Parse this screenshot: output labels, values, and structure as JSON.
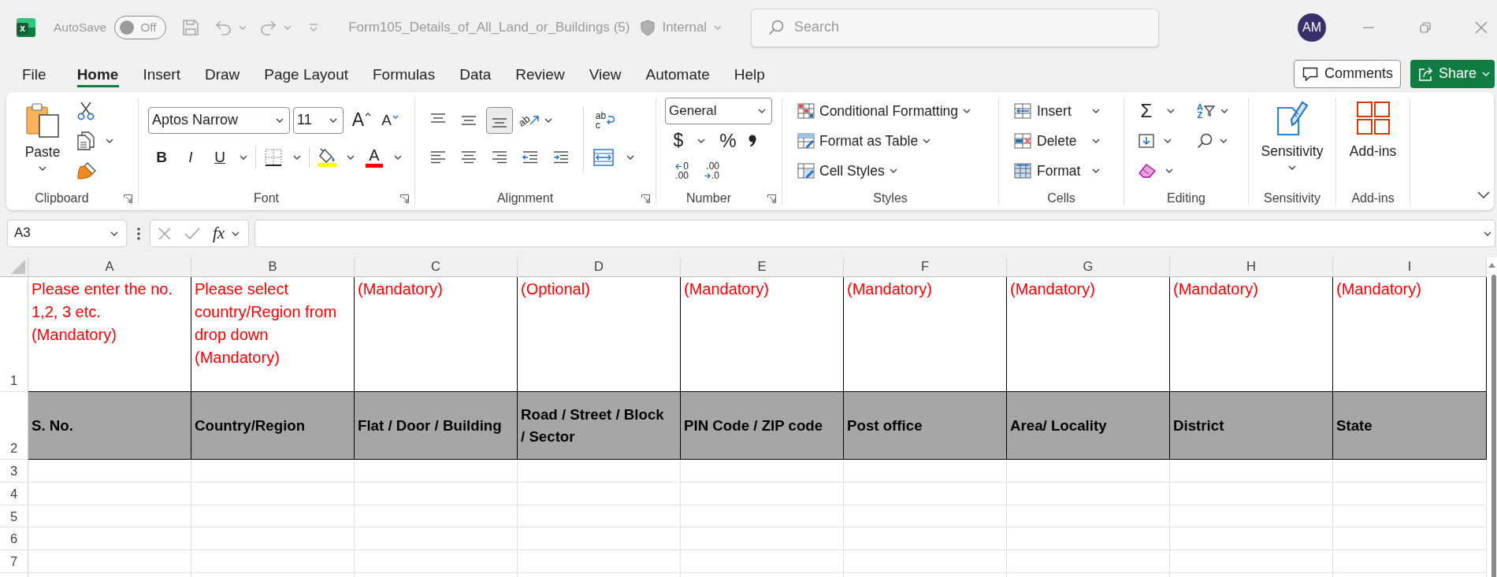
{
  "title_bar": {
    "logo_letter": "x",
    "autosave": {
      "label": "AutoSave",
      "state_text": "Off",
      "on": false
    },
    "document_title": "Form105_Details_of_All_Land_or_Buildings (5)",
    "sensitivity_label": "Internal",
    "search": {
      "placeholder": "Search"
    },
    "account_initials": "AM"
  },
  "ribbon_tabs": [
    {
      "label": "File",
      "selected": false
    },
    {
      "label": "Home",
      "selected": true
    },
    {
      "label": "Insert",
      "selected": false
    },
    {
      "label": "Draw",
      "selected": false
    },
    {
      "label": "Page Layout",
      "selected": false
    },
    {
      "label": "Formulas",
      "selected": false
    },
    {
      "label": "Data",
      "selected": false
    },
    {
      "label": "Review",
      "selected": false
    },
    {
      "label": "View",
      "selected": false
    },
    {
      "label": "Automate",
      "selected": false
    },
    {
      "label": "Help",
      "selected": false
    }
  ],
  "header_buttons": [
    {
      "kind": "comments",
      "label": "Comments"
    },
    {
      "kind": "share",
      "label": "Share"
    }
  ],
  "ribbon_groups": [
    {
      "kind": "clipboard",
      "label": "Clipboard",
      "launcher": true,
      "paste_label": "Paste"
    },
    {
      "kind": "font",
      "label": "Font",
      "launcher": true,
      "font_name": "Aptos Narrow",
      "font_size": "11",
      "grow_glyph": "A",
      "shrink_glyph": "A",
      "style_buttons": [
        "B",
        "I",
        "U"
      ],
      "font_color_glyph": "A"
    },
    {
      "kind": "alignment",
      "label": "Alignment",
      "launcher": true,
      "vertical_align": [
        {
          "selected": false
        },
        {
          "selected": false
        },
        {
          "selected": true
        }
      ],
      "orientation_glyph": "ab",
      "wrap_glyph": [
        "ab",
        "c"
      ]
    },
    {
      "kind": "number",
      "label": "Number",
      "launcher": true,
      "number_format": "General",
      "currency_glyph": "$",
      "percent_glyph": "%",
      "increase_decimal": [
        "0",
        ".00"
      ],
      "decrease_decimal": [
        ".00",
        ".0"
      ]
    },
    {
      "kind": "styles",
      "label": "Styles",
      "launcher": false,
      "items": [
        "Conditional Formatting",
        "Format as Table",
        "Cell Styles"
      ]
    },
    {
      "kind": "cells",
      "label": "Cells",
      "launcher": false,
      "items": [
        "Insert",
        "Delete",
        "Format"
      ]
    },
    {
      "kind": "editing",
      "label": "Editing",
      "launcher": false,
      "sum_glyph": "Σ",
      "sort_glyph": [
        "A",
        "Z"
      ]
    },
    {
      "kind": "sensitivity",
      "label": "Sensitivity",
      "launcher": false,
      "button_label": "Sensitivity"
    },
    {
      "kind": "addins",
      "label": "Add-ins",
      "launcher": false,
      "button_label": "Add-ins"
    }
  ],
  "formula_bar": {
    "name_box": "A3",
    "function_label": "fx"
  },
  "sheet": {
    "columns": [
      "A",
      "B",
      "C",
      "D",
      "E",
      "F",
      "G",
      "H",
      "I"
    ],
    "rows": [
      {
        "number": "1",
        "kind": "note",
        "cells": [
          "Please enter the no. 1,2, 3 etc. (Mandatory)",
          "Please select country/Region from drop down (Mandatory)",
          "(Mandatory)",
          "(Optional)",
          "(Mandatory)",
          "(Mandatory)",
          "(Mandatory)",
          "(Mandatory)",
          "(Mandatory)"
        ]
      },
      {
        "number": "2",
        "kind": "header",
        "cells": [
          "S. No.",
          "Country/Region",
          "Flat / Door / Building",
          "Road / Street / Block / Sector",
          "PIN Code / ZIP code",
          "Post office",
          "Area/ Locality",
          "District",
          "State"
        ]
      },
      {
        "number": "3",
        "kind": "blank"
      },
      {
        "number": "4",
        "kind": "blank"
      },
      {
        "number": "5",
        "kind": "blank"
      },
      {
        "number": "6",
        "kind": "blank"
      },
      {
        "number": "7",
        "kind": "blank"
      }
    ]
  }
}
